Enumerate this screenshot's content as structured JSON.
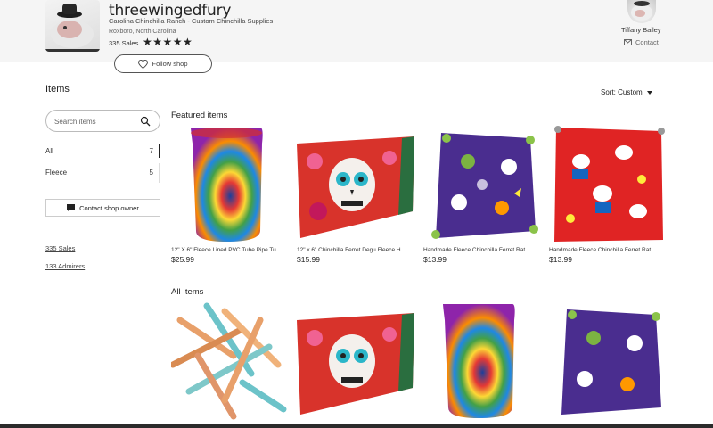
{
  "shop": {
    "name": "threewingedfury",
    "tagline": "Carolina Chinchilla Ranch - Custom Chinchilla Supplies",
    "location": "Roxboro, North Carolina",
    "sales": "335 Sales",
    "stars": "★★★★★",
    "follow_label": "Follow shop"
  },
  "owner": {
    "name": "Tiffany Bailey",
    "contact_label": "Contact"
  },
  "items_heading": "Items",
  "sort_label": "Sort: Custom",
  "search": {
    "placeholder": "Search items",
    "value": ""
  },
  "sections": [
    {
      "label": "All",
      "count": "7"
    },
    {
      "label": "Fleece",
      "count": "5"
    }
  ],
  "contact_owner_label": "Contact shop owner",
  "side_links": [
    "335 Sales",
    "133 Admirers"
  ],
  "featured_heading": "Featured items",
  "featured": [
    {
      "title": "12\" X 6\" Fleece Lined PVC Tube Pipe Tu...",
      "price": "$25.99",
      "image": "tie-dye-tube"
    },
    {
      "title": "12\" x 6\" Chinchilla Ferret Degu Fleece H...",
      "price": "$15.99",
      "image": "sugar-skull-hammock"
    },
    {
      "title": "Handmade Fleece Chinchilla Ferret Rat ...",
      "price": "$13.99",
      "image": "purple-halloween-hammock"
    },
    {
      "title": "Handmade Fleece Chinchilla Ferret Rat ...",
      "price": "$13.99",
      "image": "red-hello-kitty-hammock"
    }
  ],
  "all_heading": "All Items",
  "all_items": [
    {
      "image": "wooden-chew-sticks"
    },
    {
      "image": "sugar-skull-hammock"
    },
    {
      "image": "tie-dye-tube"
    },
    {
      "image": "purple-halloween-hammock"
    }
  ],
  "colors": {
    "accent": "#222222",
    "header_bg": "#f5f5f5"
  }
}
